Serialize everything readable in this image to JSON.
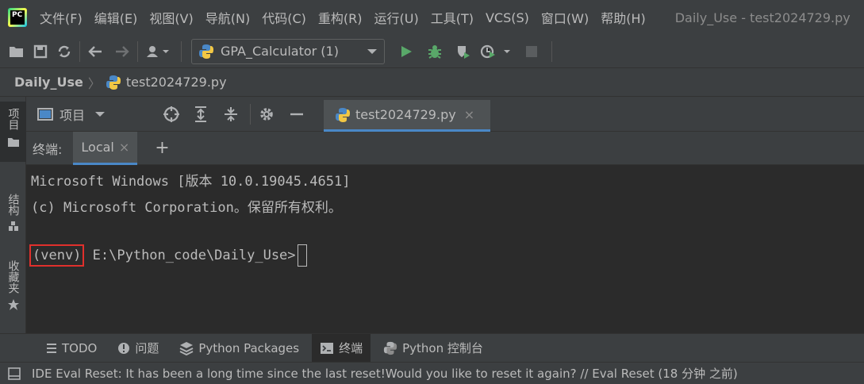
{
  "menubar": {
    "logo_text": "PC",
    "items": [
      "文件(F)",
      "编辑(E)",
      "视图(V)",
      "导航(N)",
      "代码(C)",
      "重构(R)",
      "运行(U)",
      "工具(T)",
      "VCS(S)",
      "窗口(W)",
      "帮助(H)"
    ],
    "window_title": "Daily_Use - test2024729.py"
  },
  "toolbar": {
    "run_config_label": "GPA_Calculator (1)",
    "icons": [
      "open-folder-icon",
      "save-icon",
      "sync-icon",
      "back-arrow-icon",
      "forward-arrow-icon",
      "user-dropdown-icon",
      "run-icon",
      "debug-icon",
      "coverage-icon",
      "profile-icon",
      "stop-icon"
    ]
  },
  "navbar": {
    "root": "Daily_Use",
    "separator": "〉",
    "file": "test2024729.py"
  },
  "left_strip": {
    "project": "项目",
    "structure": "结构",
    "favorites": "收藏夹"
  },
  "project_panel": {
    "title": "项目"
  },
  "editor": {
    "tab_label": "test2024729.py",
    "close": "×"
  },
  "terminal": {
    "header_label": "终端:",
    "tab_label": "Local",
    "tab_close": "×",
    "add": "+",
    "lines": [
      "Microsoft Windows [版本 10.0.19045.4651]",
      "(c) Microsoft Corporation。保留所有权利。"
    ],
    "venv": "(venv)",
    "prompt": " E:\\Python_code\\Daily_Use>"
  },
  "bottom_tabs": {
    "todo": "TODO",
    "problems": "问题",
    "packages": "Python Packages",
    "terminal": "终端",
    "console": "Python 控制台"
  },
  "status_bar": {
    "message": "IDE Eval Reset: It has been a long time since the last reset!Would you like to reset it again? // Eval Reset (18 分钟 之前)"
  },
  "colors": {
    "background": "#2b2b2b",
    "panel": "#3c3f41",
    "text": "#bbbbbb",
    "run_green": "#59a869",
    "highlight_red": "#e0302c",
    "tab_underline": "#4a88c7"
  }
}
